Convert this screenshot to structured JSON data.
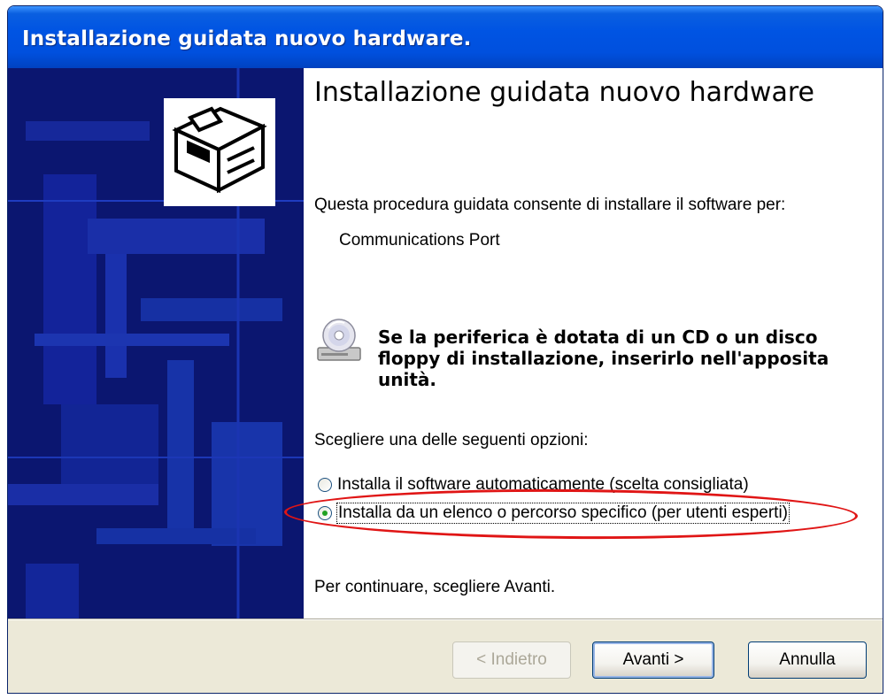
{
  "window": {
    "title": "Installazione guidata nuovo hardware."
  },
  "content": {
    "heading": "Installazione guidata nuovo hardware",
    "intro": "Questa procedura guidata consente di installare il software per:",
    "device_name": "Communications Port",
    "cd_message": "Se la periferica è dotata di un CD o un disco floppy di installazione, inserirlo nell'apposita unità.",
    "choose_prompt": "Scegliere una delle seguenti opzioni:",
    "options": [
      {
        "label": "Installa il software automaticamente (scelta consigliata)",
        "selected": false
      },
      {
        "label": "Installa da un elenco o percorso specifico (per utenti esperti)",
        "selected": true
      }
    ],
    "continue_text": "Per continuare, scegliere Avanti."
  },
  "buttons": {
    "back": "< Indietro",
    "next": "Avanti >",
    "cancel": "Annulla"
  },
  "icons": {
    "wizard": "hardware-wizard-icon",
    "cd": "cd-drive-icon"
  },
  "colors": {
    "titlebar": "#0054e3",
    "side_panel": "#0d1a78",
    "footer": "#ece9d8",
    "annotation": "#e01515"
  }
}
